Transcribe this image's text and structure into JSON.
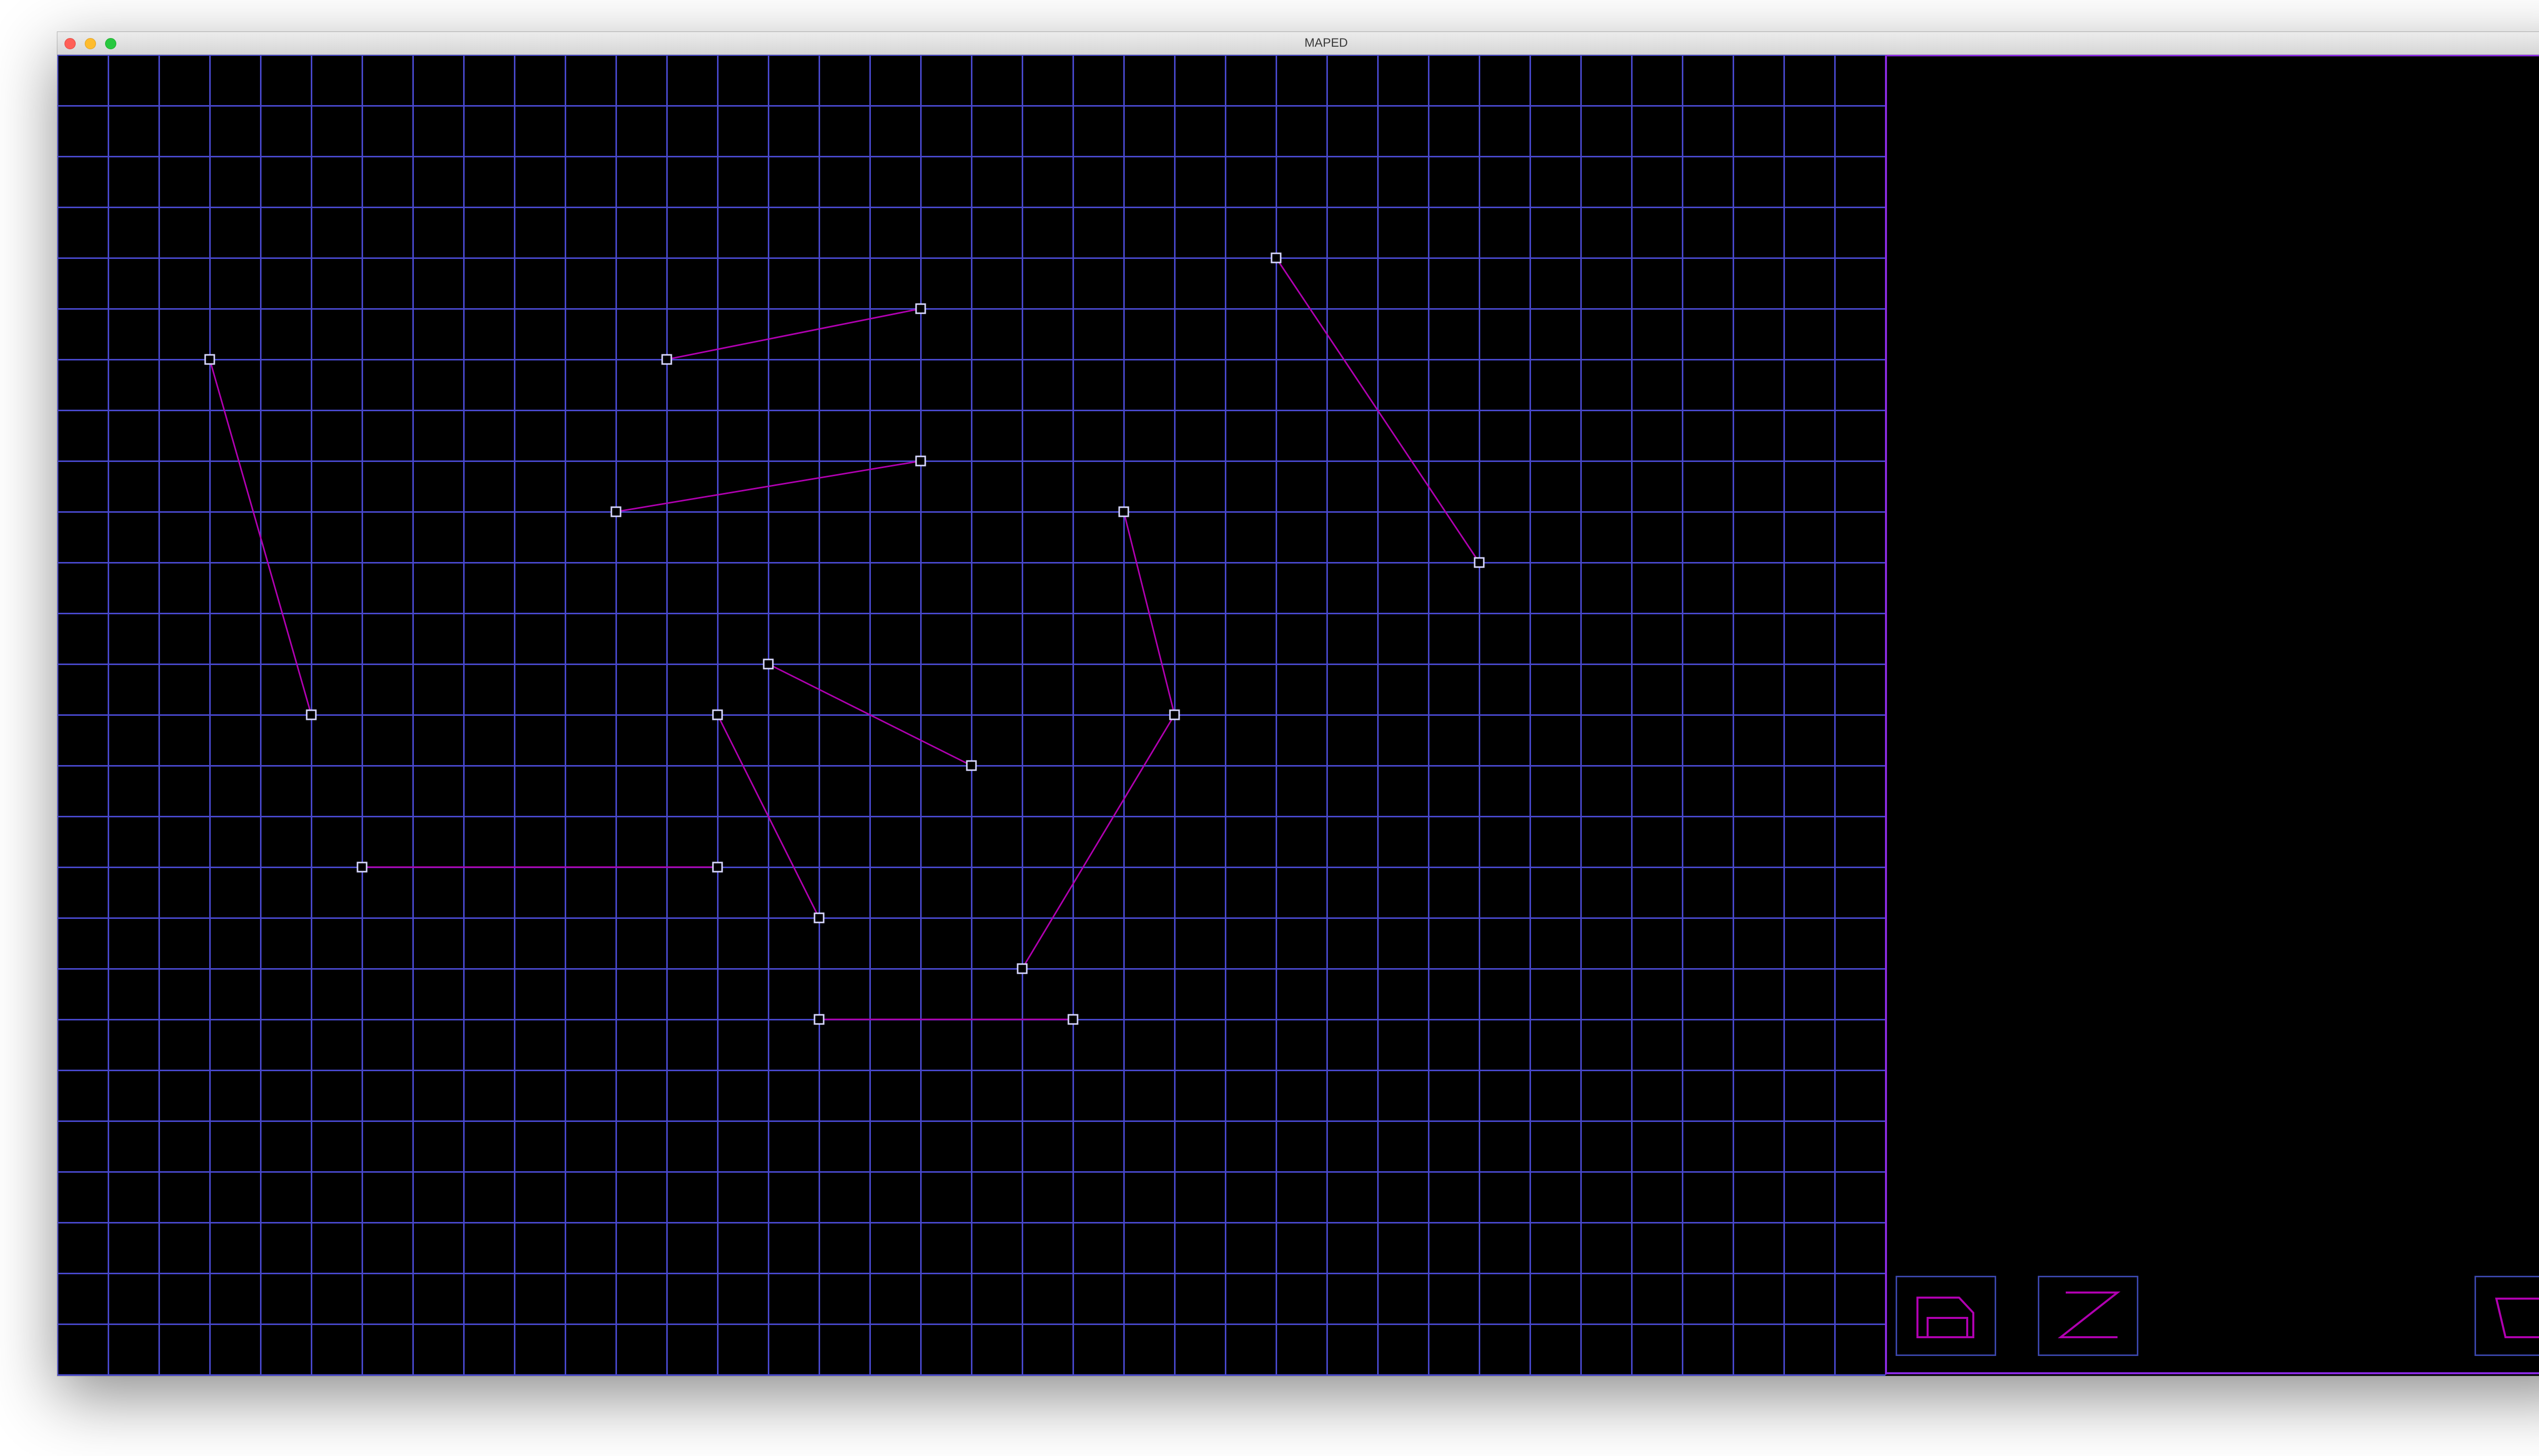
{
  "window": {
    "title": "MAPED"
  },
  "colors": {
    "background": "#000000",
    "grid": "#4848cc",
    "line": "#b000b0",
    "vertex": "#d8d8ff",
    "panel_border": "#8a2be2",
    "button_border": "#3a45a8"
  },
  "grid": {
    "cols": 36,
    "rows": 26
  },
  "map": {
    "segments": [
      {
        "from": [
          12,
          6
        ],
        "to": [
          17,
          5
        ]
      },
      {
        "from": [
          3,
          6
        ],
        "to": [
          5,
          13
        ]
      },
      {
        "from": [
          11,
          9
        ],
        "to": [
          17,
          8
        ]
      },
      {
        "from": [
          24,
          4
        ],
        "to": [
          28,
          10
        ]
      },
      {
        "from": [
          21,
          9
        ],
        "to": [
          22,
          13
        ]
      },
      {
        "from": [
          22,
          13
        ],
        "to": [
          19,
          18
        ]
      },
      {
        "from": [
          14,
          12
        ],
        "to": [
          18,
          14
        ]
      },
      {
        "from": [
          13,
          13
        ],
        "to": [
          15,
          17
        ]
      },
      {
        "from": [
          6,
          16
        ],
        "to": [
          13,
          16
        ]
      },
      {
        "from": [
          15,
          19
        ],
        "to": [
          20,
          19
        ]
      }
    ]
  },
  "toolbar": {
    "buttons": [
      {
        "name": "sector-tool-button",
        "icon": "sector-shape-icon"
      },
      {
        "name": "line-tool-button",
        "icon": "z-line-icon"
      },
      {
        "name": "trapezoid-tool-button",
        "icon": "trapezoid-icon"
      }
    ]
  }
}
